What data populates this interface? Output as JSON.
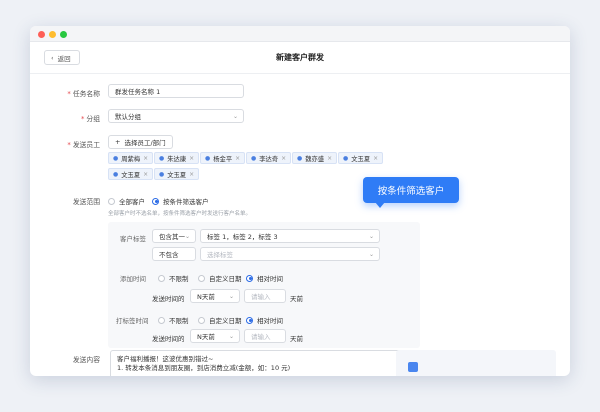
{
  "header": {
    "back_label": "返回",
    "title": "新建客户群发"
  },
  "form": {
    "task_name": {
      "label": "任务名称",
      "value": "群发任务名称 1"
    },
    "group": {
      "label": "分组",
      "value": "默认分组"
    },
    "staff": {
      "label": "发送员工",
      "add_label": "选择员工/部门",
      "tags": [
        "周紫梅",
        "朱达康",
        "杨金平",
        "李达奇",
        "魏亦盛",
        "文玉夏",
        "文玉夏",
        "文玉夏"
      ]
    },
    "scope": {
      "label": "发送范围",
      "options": [
        "全部客户",
        "按条件筛选客户"
      ],
      "hint": "全部客户时不选名单，按条件筛选客户时发送行客户名单。"
    },
    "filter": {
      "tag_label": "客户标签",
      "include_value": "包含其一",
      "include_tags": "标签 1，标签 2，标签 3",
      "exclude_value": "不包含",
      "exclude_placeholder": "选择标签",
      "add_time": {
        "label": "添加时间",
        "options": [
          "不限制",
          "自定义日期",
          "相对时间"
        ],
        "send_label": "发送时间的",
        "days": "N天前",
        "placeholder": "请输入",
        "suffix": "天前"
      },
      "tag_time": {
        "label": "打标签时间",
        "options": [
          "不限制",
          "自定义日期",
          "相对时间"
        ],
        "send_label": "发送时间的",
        "days": "N天前",
        "placeholder": "请输入",
        "suffix": "天前"
      }
    },
    "content": {
      "label": "发送内容",
      "line1": "客户福利播报！这波优惠别错过~",
      "line2": "1. 转发本条消息到朋友圈，到店消费立减(金额，如：10 元)"
    }
  },
  "callout": {
    "text": "按条件筛选客户"
  },
  "colors": {
    "primary": "#2f7cf6",
    "required": "#e5484d"
  }
}
